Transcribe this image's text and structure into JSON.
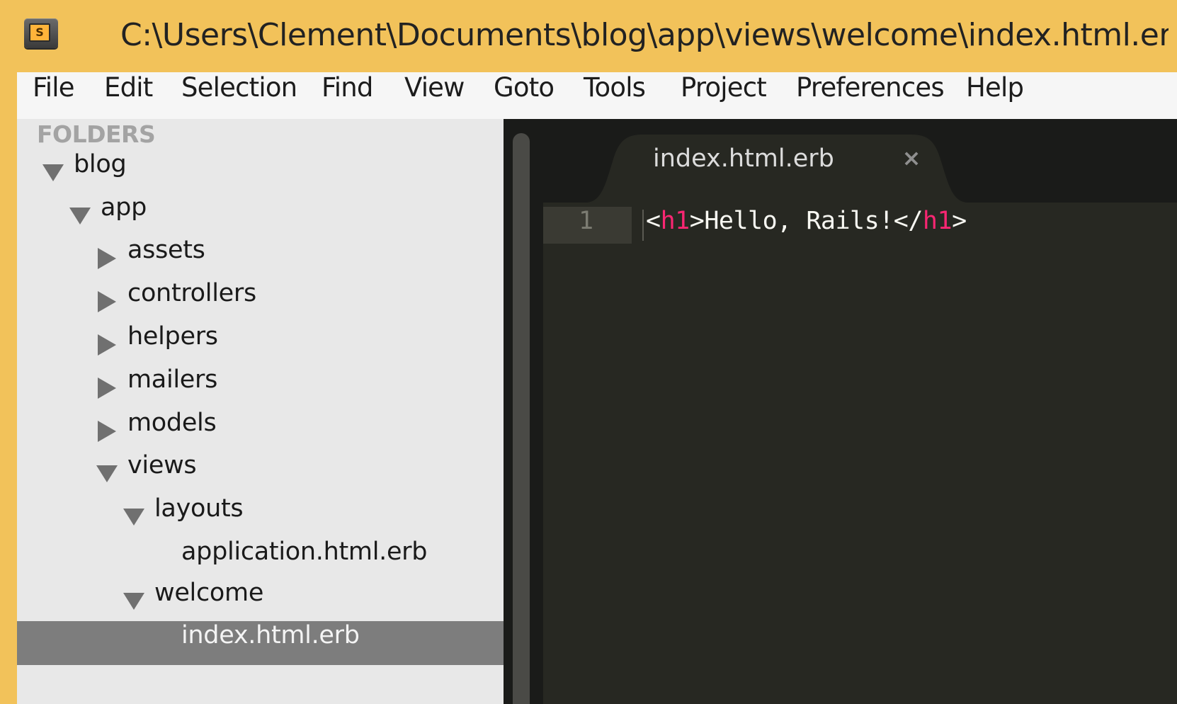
{
  "window": {
    "title": "C:\\Users\\Clement\\Documents\\blog\\app\\views\\welcome\\index.html.erb",
    "app_icon_letter": "S"
  },
  "menu": [
    "File",
    "Edit",
    "Selection",
    "Find",
    "View",
    "Goto",
    "Tools",
    "Project",
    "Preferences",
    "Help"
  ],
  "sidebar": {
    "header": "FOLDERS",
    "tree": [
      {
        "label": "blog",
        "expanded": true
      },
      {
        "label": "app",
        "expanded": true
      },
      {
        "label": "assets",
        "expanded": false
      },
      {
        "label": "controllers",
        "expanded": false
      },
      {
        "label": "helpers",
        "expanded": false
      },
      {
        "label": "mailers",
        "expanded": false
      },
      {
        "label": "models",
        "expanded": false
      },
      {
        "label": "views",
        "expanded": true
      },
      {
        "label": "layouts",
        "expanded": true
      },
      {
        "label": "application.html.erb"
      },
      {
        "label": "welcome",
        "expanded": true
      },
      {
        "label": "index.html.erb",
        "selected": true
      }
    ]
  },
  "editor": {
    "tab": {
      "label": "index.html.erb",
      "close": "×"
    },
    "lines": [
      {
        "number": "1",
        "tokens": {
          "open_lt": "<",
          "open_tag": "h1",
          "open_gt": ">",
          "text": "Hello, Rails!",
          "close_lt": "</",
          "close_tag": "h1",
          "close_gt": ">"
        }
      }
    ]
  },
  "colors": {
    "title_bar": "#f2c25a",
    "sidebar_bg": "#e8e8e8",
    "selected_row": "#7d7d7d",
    "editor_bg": "#272822",
    "tag": "#f92672",
    "text": "#f8f8f2"
  }
}
